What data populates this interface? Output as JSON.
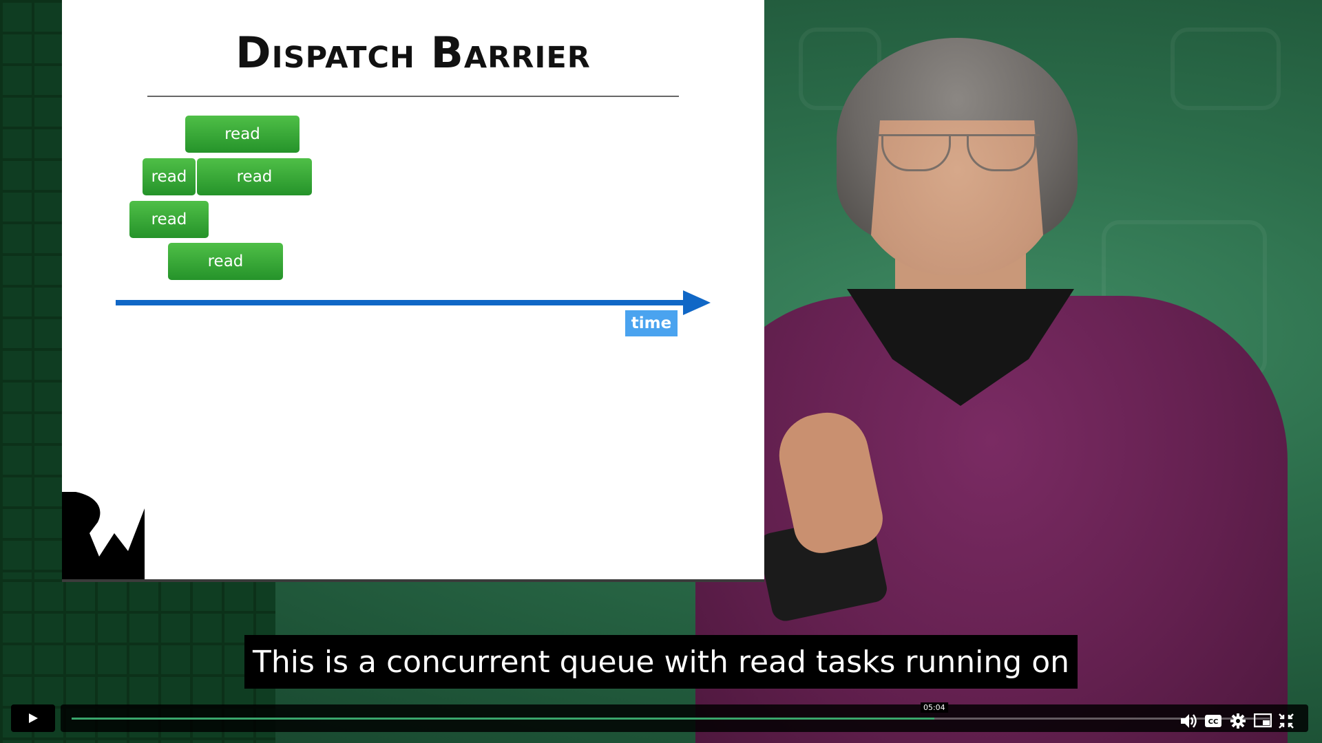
{
  "slide": {
    "title": "Dispatch Barrier",
    "tasks": [
      {
        "label": "read"
      },
      {
        "label": "read"
      },
      {
        "label": "read"
      },
      {
        "label": "read"
      },
      {
        "label": "read"
      }
    ],
    "axis_label": "time"
  },
  "caption": {
    "text": "This is a concurrent queue with read tasks running on"
  },
  "player": {
    "current_time": "05:04",
    "progress_fraction": 0.72,
    "icons": {
      "play": "play-icon",
      "volume": "volume-icon",
      "captions": "closed-captions-icon",
      "settings": "gear-icon",
      "pip": "picture-in-picture-icon",
      "fullscreen": "exit-fullscreen-icon"
    },
    "accent_color": "#3aa66c"
  },
  "colors": {
    "task_green": "#25932a",
    "axis_blue": "#1067c6",
    "label_blue": "#4aa3ef",
    "sweater": "#63204f"
  }
}
